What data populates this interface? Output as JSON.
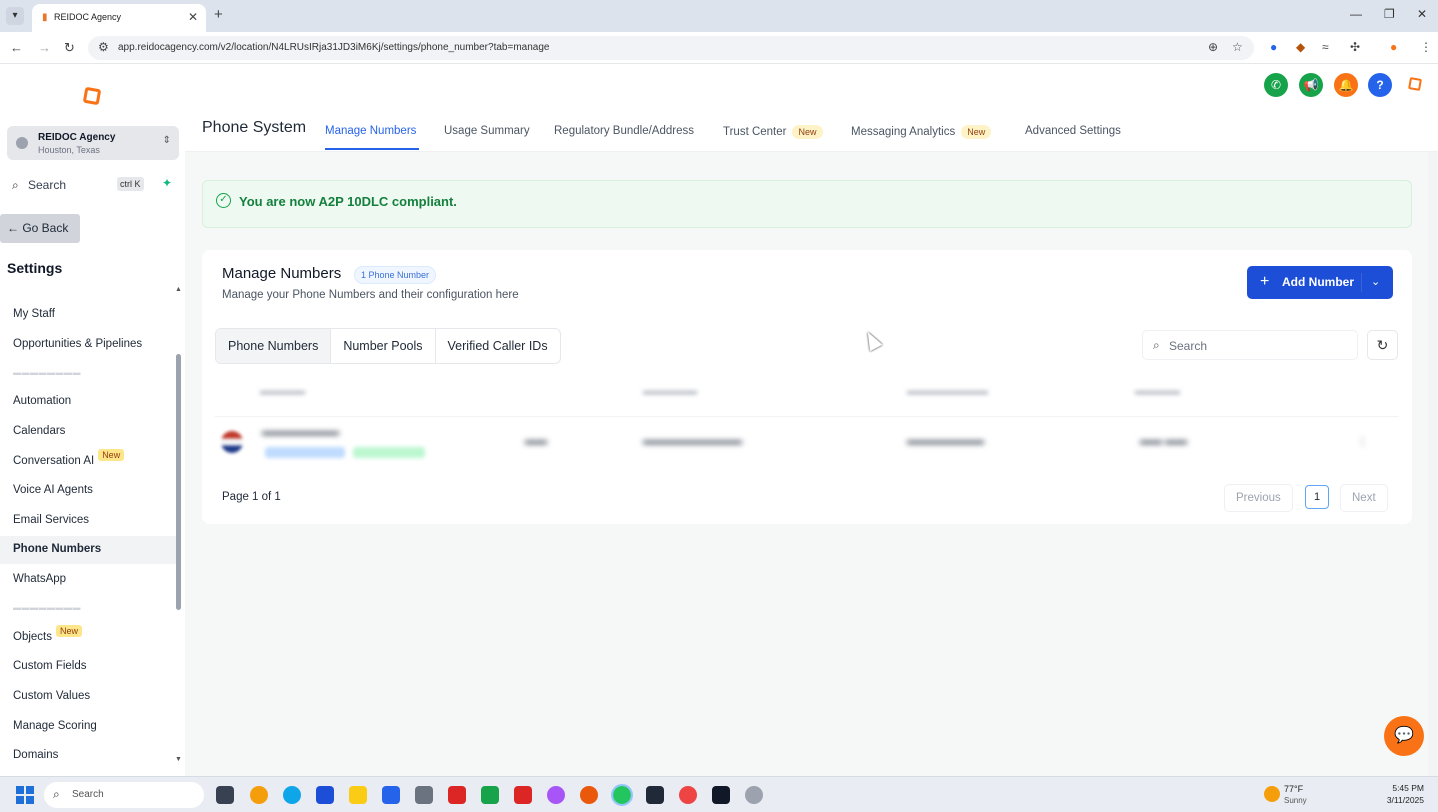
{
  "browser": {
    "tab_title": "REIDOC Agency",
    "url": "app.reidocagency.com/v2/location/N4LRUsIRja31JD3iM6Kj/settings/phone_number?tab=manage"
  },
  "sidebar": {
    "account_name": "REIDOC Agency",
    "account_location": "Houston, Texas",
    "search_label": "Search",
    "search_shortcut": "ctrl K",
    "go_back": "← Go Back",
    "settings_title": "Settings",
    "items": [
      {
        "label": "My Staff",
        "badge": ""
      },
      {
        "label": "Opportunities & Pipelines",
        "badge": ""
      },
      {
        "label": "Automation",
        "badge": ""
      },
      {
        "label": "Calendars",
        "badge": ""
      },
      {
        "label": "Conversation AI",
        "badge": "New"
      },
      {
        "label": "Voice AI Agents",
        "badge": ""
      },
      {
        "label": "Email Services",
        "badge": ""
      },
      {
        "label": "Phone Numbers",
        "badge": "",
        "active": true
      },
      {
        "label": "WhatsApp",
        "badge": ""
      },
      {
        "label": "Objects",
        "badge": "New"
      },
      {
        "label": "Custom Fields",
        "badge": ""
      },
      {
        "label": "Custom Values",
        "badge": ""
      },
      {
        "label": "Manage Scoring",
        "badge": ""
      },
      {
        "label": "Domains",
        "badge": ""
      }
    ]
  },
  "header": {
    "page_title": "Phone System",
    "tabs": [
      {
        "label": "Manage Numbers",
        "badge": ""
      },
      {
        "label": "Usage Summary",
        "badge": ""
      },
      {
        "label": "Regulatory Bundle/Address",
        "badge": ""
      },
      {
        "label": "Trust Center",
        "badge": "New"
      },
      {
        "label": "Messaging Analytics",
        "badge": "New"
      },
      {
        "label": "Advanced Settings",
        "badge": ""
      }
    ],
    "icon_colors": {
      "phone": "#16a34a",
      "megaphone": "#16a34a",
      "bell": "#f97316",
      "help": "#2563eb"
    }
  },
  "alert": {
    "text": "You are now A2P 10DLC compliant."
  },
  "card": {
    "title": "Manage Numbers",
    "count_badge": "1 Phone Number",
    "subtitle": "Manage your Phone Numbers and their configuration here",
    "add_button": "Add Number",
    "segments": [
      "Phone Numbers",
      "Number Pools",
      "Verified Caller IDs"
    ],
    "search_placeholder": "Search",
    "page_info": "Page 1 of 1",
    "prev_label": "Previous",
    "page_number": "1",
    "next_label": "Next",
    "accent_color": "#1d4ed8"
  },
  "taskbar": {
    "search_label": "Search",
    "temperature": "77°F",
    "condition": "Sunny",
    "time": "5:45 PM",
    "date": "3/11/2025"
  }
}
